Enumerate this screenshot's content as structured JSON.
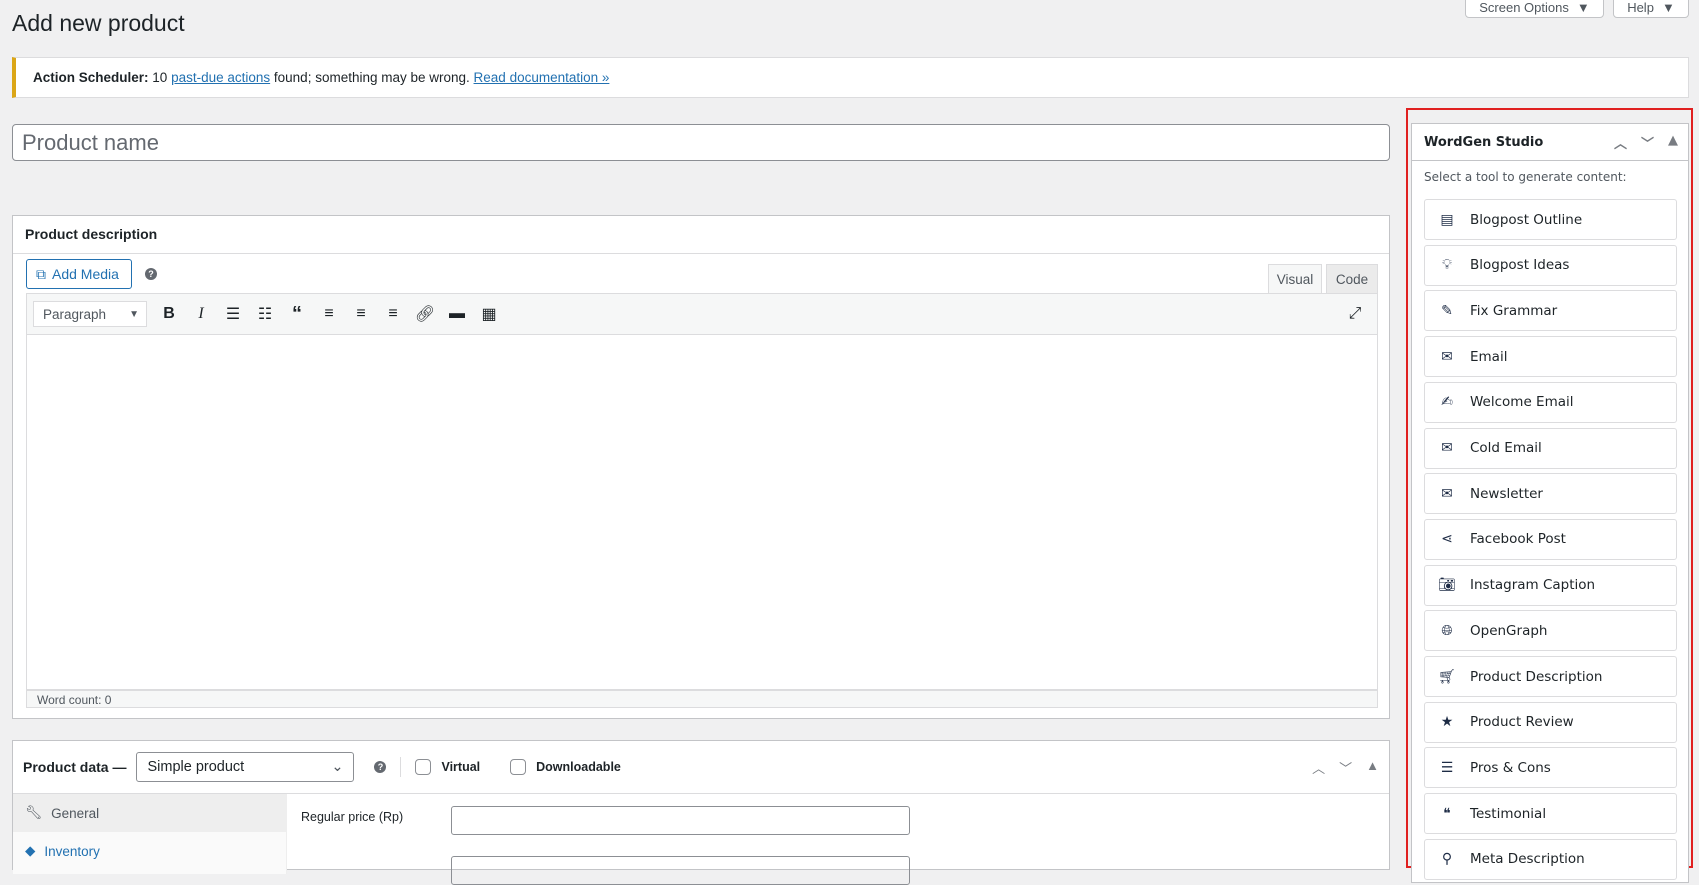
{
  "header": {
    "title": "Add new product",
    "screen_options": "Screen Options",
    "help": "Help"
  },
  "notice": {
    "label": "Action Scheduler:",
    "count": "10",
    "link1": "past-due actions",
    "text": "found; something may be wrong.",
    "link2": "Read documentation »"
  },
  "product_name": {
    "placeholder": "Product name"
  },
  "description": {
    "title": "Product description",
    "add_media": "Add Media",
    "tab_visual": "Visual",
    "tab_code": "Code",
    "format": "Paragraph",
    "word_count": "Word count: 0"
  },
  "product_data": {
    "title": "Product data —",
    "type": "Simple product",
    "virtual": "Virtual",
    "downloadable": "Downloadable",
    "tabs": [
      "General",
      "Inventory"
    ],
    "regular_price": "Regular price (Rp)"
  },
  "wordgen": {
    "title": "WordGen Studio",
    "subtitle": "Select a tool to generate content:",
    "tools": [
      {
        "label": "Blogpost Outline",
        "icon": "list-table-icon"
      },
      {
        "label": "Blogpost Ideas",
        "icon": "lightbulb-icon"
      },
      {
        "label": "Fix Grammar",
        "icon": "pencil-icon"
      },
      {
        "label": "Email",
        "icon": "email-icon"
      },
      {
        "label": "Welcome Email",
        "icon": "edit-email-icon"
      },
      {
        "label": "Cold Email",
        "icon": "email-icon"
      },
      {
        "label": "Newsletter",
        "icon": "envelope-icon"
      },
      {
        "label": "Facebook Post",
        "icon": "share-icon"
      },
      {
        "label": "Instagram Caption",
        "icon": "camera-icon"
      },
      {
        "label": "OpenGraph",
        "icon": "globe-icon"
      },
      {
        "label": "Product Description",
        "icon": "cart-icon"
      },
      {
        "label": "Product Review",
        "icon": "star-icon"
      },
      {
        "label": "Pros & Cons",
        "icon": "list-icon"
      },
      {
        "label": "Testimonial",
        "icon": "quote-icon"
      },
      {
        "label": "Meta Description",
        "icon": "search-icon"
      }
    ]
  }
}
